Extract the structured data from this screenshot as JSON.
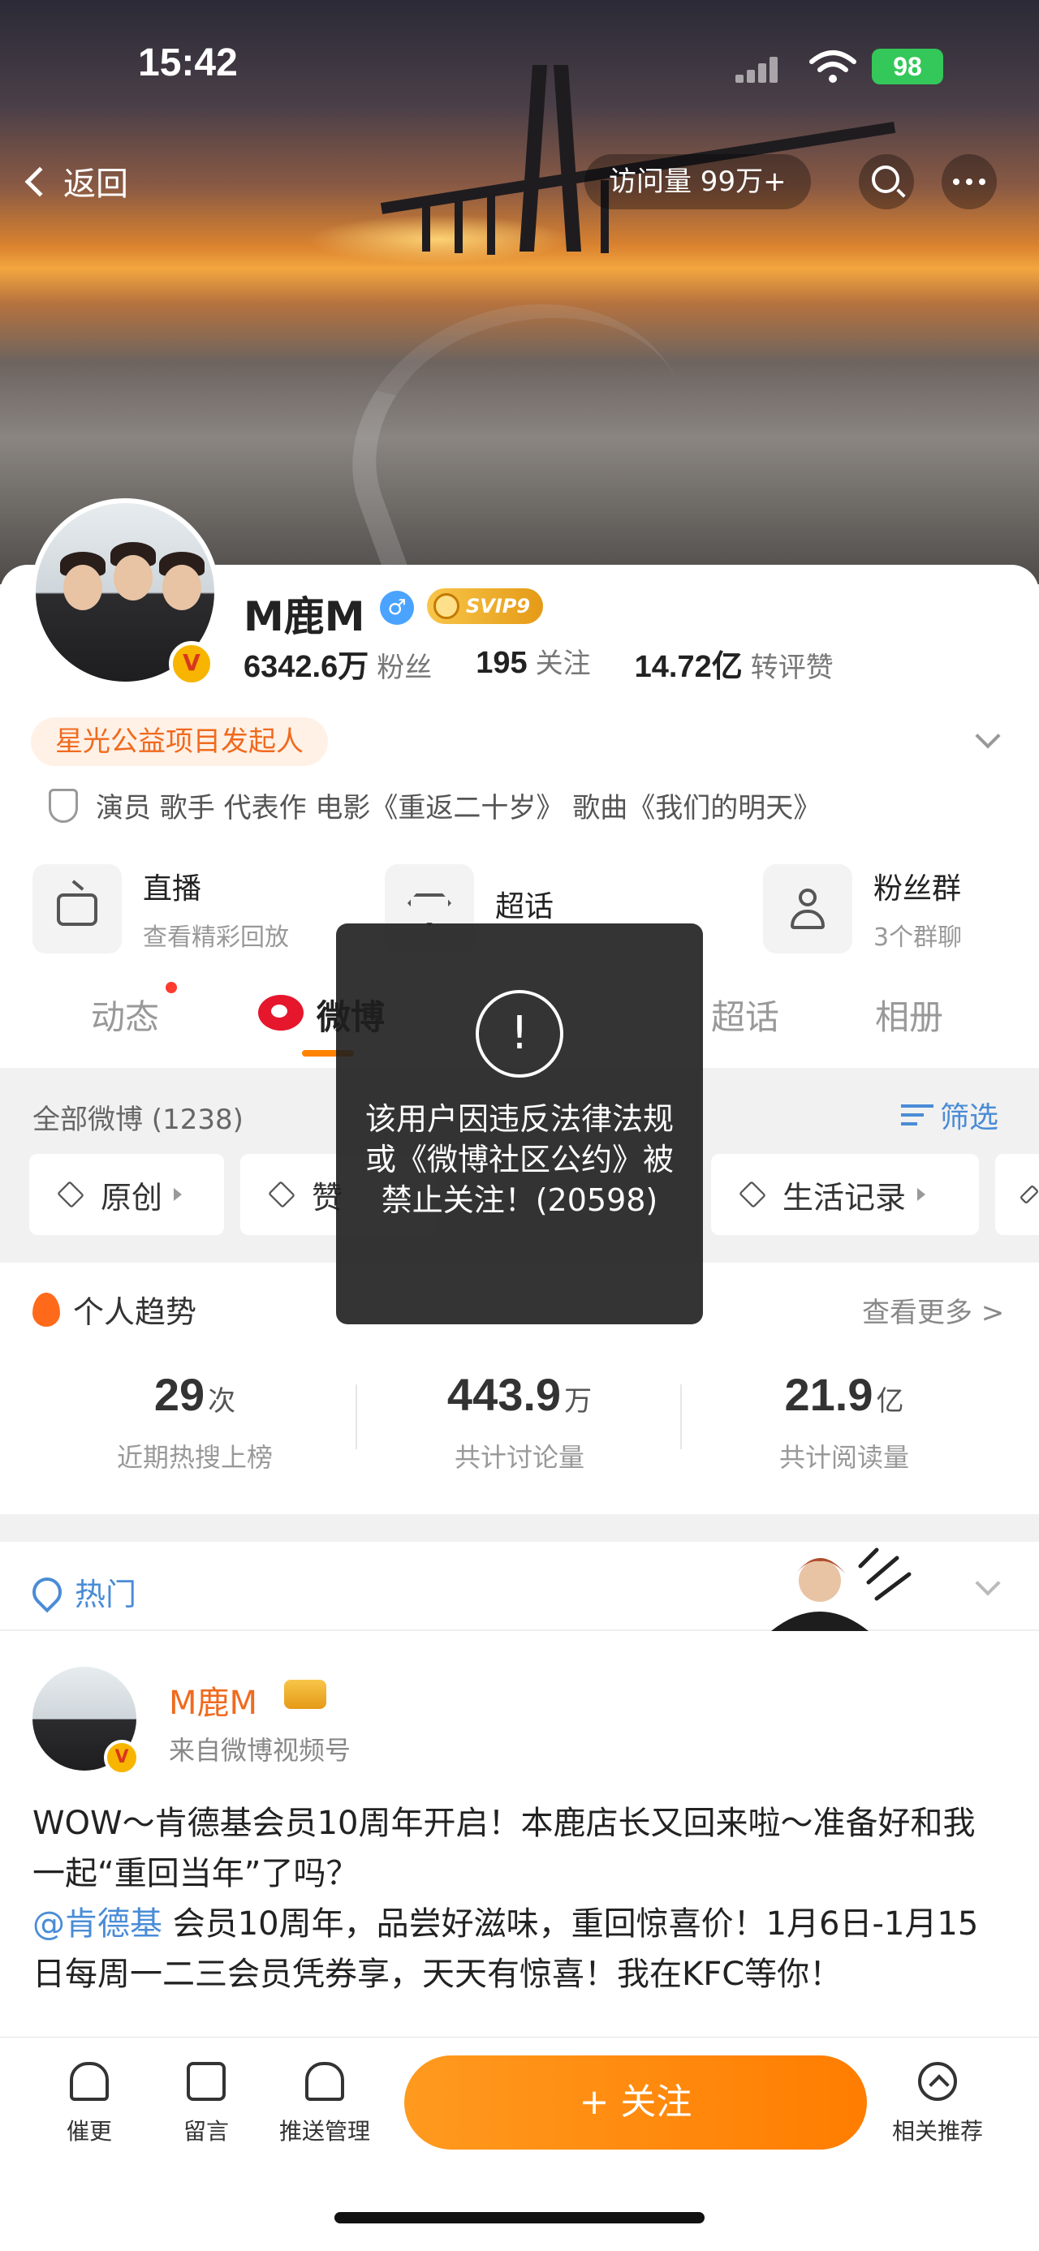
{
  "status_bar": {
    "time": "15:42",
    "battery": "98"
  },
  "nav": {
    "back_label": "返回",
    "visits": "访问量 99万+"
  },
  "profile": {
    "name": "M鹿M",
    "verified_mark": "V",
    "svip": "SVIP9",
    "stats": [
      {
        "value": "6342.6万",
        "label": "粉丝"
      },
      {
        "value": "195",
        "label": "关注"
      },
      {
        "value": "14.72亿",
        "label": "转评赞"
      }
    ],
    "tag": "星光公益项目发起人",
    "description": "演员 歌手 代表作 电影《重返二十岁》 歌曲《我们的明天》"
  },
  "features": [
    {
      "title": "直播",
      "subtitle": "查看精彩回放"
    },
    {
      "title": "超话",
      "subtitle": ""
    },
    {
      "title": "粉丝群",
      "subtitle": "3个群聊"
    }
  ],
  "tabs": [
    "动态",
    "微博",
    "",
    "超话",
    "相册"
  ],
  "filter": {
    "title": "全部微博 (1238)",
    "button": "筛选",
    "chips": [
      "原创",
      "赞",
      "",
      "生活记录",
      ""
    ]
  },
  "trend": {
    "title": "个人趋势",
    "more": "查看更多 >",
    "items": [
      {
        "value": "29",
        "unit": "次",
        "label": "近期热搜上榜"
      },
      {
        "value": "443.9",
        "unit": "万",
        "label": "共计讨论量"
      },
      {
        "value": "21.9",
        "unit": "亿",
        "label": "共计阅读量"
      }
    ]
  },
  "hot": {
    "label": "热门"
  },
  "post": {
    "author": "M鹿M",
    "source": "来自微博视频号",
    "text_line1": "WOW～肯德基会员10周年开启！本鹿店长又回来啦～准备好和我一起“重回当年”了吗？",
    "mention": "@肯德基",
    "text_line2": " 会员10周年，品尝好滋味，重回惊喜价！1月6日-1月15日每周一二三会员凭券享，天天有惊喜！我在KFC等你！"
  },
  "bottom_bar": {
    "remind": "催更",
    "message": "留言",
    "push": "推送管理",
    "follow": "+ 关注",
    "related": "相关推荐"
  },
  "toast": {
    "icon": "!",
    "message": "该用户因违反法律法规或《微博社区公约》被禁止关注！(20598)"
  }
}
